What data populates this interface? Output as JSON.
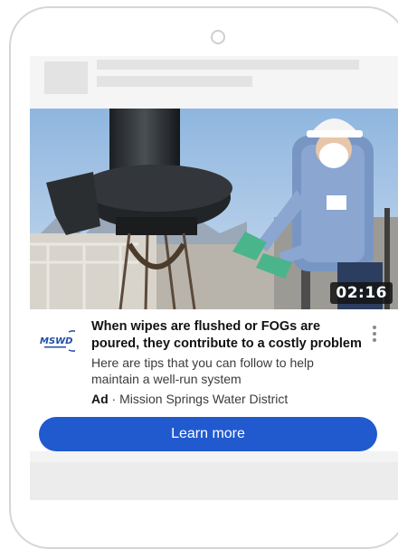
{
  "video": {
    "duration": "02:16"
  },
  "advertiser": {
    "logo_text": "MSWD",
    "name": "Mission Springs Water District"
  },
  "ad": {
    "headline": "When wipes are flushed or FOGs are poured, they contribute to a costly problem",
    "description": "Here are tips that you can follow to help maintain a well-run system",
    "ad_label": "Ad",
    "separator": " · ",
    "cta_label": "Learn more"
  },
  "colors": {
    "cta_background": "#2159cf",
    "logo_blue": "#1f4fa8"
  },
  "icons": {
    "more": "more-vertical-icon",
    "camera": "camera-icon"
  }
}
